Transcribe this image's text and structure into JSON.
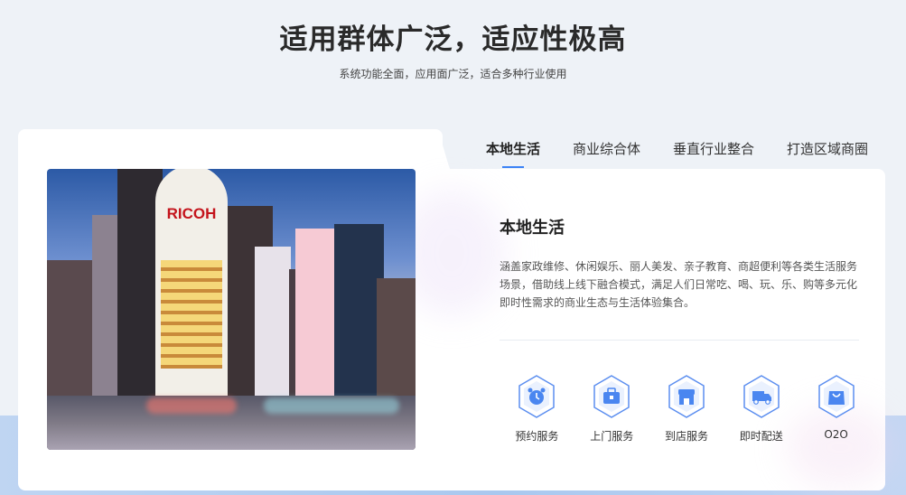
{
  "header": {
    "title": "适用群体广泛，适应性极高",
    "subtitle": "系统功能全面，应用面广泛，适合多种行业使用"
  },
  "tabs": [
    {
      "label": "本地生活",
      "active": true
    },
    {
      "label": "商业综合体",
      "active": false
    },
    {
      "label": "垂直行业整合",
      "active": false
    },
    {
      "label": "打造区域商圈",
      "active": false
    }
  ],
  "panel": {
    "title": "本地生活",
    "description": "涵盖家政维修、休闲娱乐、丽人美发、亲子教育、商超便利等各类生活服务场景，借助线上线下融合模式，满足人们日常吃、喝、玩、乐、购等多元化即时性需求的商业生态与生活体验集合。",
    "photo_sign": "RICOH"
  },
  "services": [
    {
      "label": "预约服务",
      "icon": "alarm-clock-icon"
    },
    {
      "label": "上门服务",
      "icon": "toolbox-icon"
    },
    {
      "label": "到店服务",
      "icon": "storefront-icon"
    },
    {
      "label": "即时配送",
      "icon": "delivery-truck-icon"
    },
    {
      "label": "O2O",
      "icon": "shopping-bag-icon"
    }
  ],
  "colors": {
    "accent": "#3b82f6",
    "page_bg": "#eef2f7",
    "bottom_band": "#a9c8ef"
  }
}
